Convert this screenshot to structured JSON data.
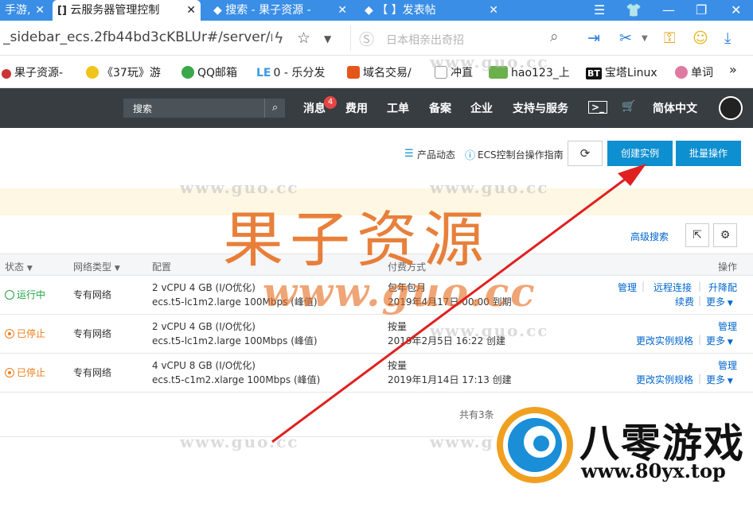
{
  "browser": {
    "tabs": [
      {
        "title": "手游,"
      },
      {
        "title": "云服务器管理控制"
      },
      {
        "title": "搜索 - 果子资源 -"
      },
      {
        "title": "【       】发表帖"
      }
    ],
    "url": "_sidebar_ecs.2fb44bd3cKBLUr#/server/re",
    "search_placeholder": "日本相亲出奇招",
    "bookmarks": [
      {
        "label": "果子资源-"
      },
      {
        "label": "《37玩》游"
      },
      {
        "label": "QQ邮箱"
      },
      {
        "label": "0 - 乐分发"
      },
      {
        "label": "域名交易/"
      },
      {
        "label": "冲直"
      },
      {
        "label": "hao123_上"
      },
      {
        "label": "宝塔Linux"
      },
      {
        "label": "单词"
      }
    ],
    "bookmark_prefixes": {
      "le": "LE",
      "bt": "BT"
    },
    "more_label": "»"
  },
  "topbar": {
    "search_placeholder": "搜索",
    "nav": {
      "messages": "消息",
      "messages_badge": "4",
      "fees": "费用",
      "tickets": "工单",
      "filing": "备案",
      "enterprise": "企业",
      "support": "支持与服务",
      "language": "简体中文"
    }
  },
  "toolbar": {
    "product_news": "产品动态",
    "guide": "ECS控制台操作指南",
    "create_instance": "创建实例",
    "batch_ops": "批量操作",
    "advanced_search": "高级搜索"
  },
  "table": {
    "headers": {
      "status": "状态",
      "network": "网络类型",
      "config": "配置",
      "billing": "付费方式",
      "actions": "操作"
    },
    "rows": [
      {
        "status": "运行中",
        "network": "专有网络",
        "config_line1": "2 vCPU 4 GB (I/O优化)",
        "config_line2": "ecs.t5-lc1m2.large   100Mbps (峰值)",
        "billing_line1": "包年包月",
        "billing_line2": "2019年4月17日 00:00 到期",
        "action_a": "管理",
        "action_b": "远程连接",
        "action_c": "升降配",
        "action_d": "续费",
        "action_more": "更多"
      },
      {
        "status": "已停止",
        "network": "专有网络",
        "config_line1": "2 vCPU 4 GB (I/O优化)",
        "config_line2": "ecs.t5-lc1m2.large   100Mbps (峰值)",
        "billing_line1": "按量",
        "billing_line2": "2019年2月5日 16:22 创建",
        "action_a": "管理",
        "action_b": "更改实例规格",
        "action_more": "更多"
      },
      {
        "status": "已停止",
        "network": "专有网络",
        "config_line1": "4 vCPU 8 GB (I/O优化)",
        "config_line2": "ecs.t5-c1m2.xlarge   100Mbps (峰值)",
        "billing_line1": "按量",
        "billing_line2": "2019年1月14日 17:13 创建",
        "action_a": "管理",
        "action_b": "更改实例规格",
        "action_more": "更多"
      }
    ],
    "total": "共有3条,"
  },
  "watermarks": {
    "small": "www.guo.cc",
    "big": "果子资源",
    "url_big": "www.guo.cc"
  },
  "logo": {
    "name": "八零游戏",
    "url": "www.80yx.top"
  },
  "colors": {
    "tabbar": "#3a8ee6",
    "topbar": "#373d41",
    "primary_button": "#0e8fd0",
    "running": "#1ea245",
    "stopped": "#ef7d1a",
    "arrow": "#e02020"
  }
}
